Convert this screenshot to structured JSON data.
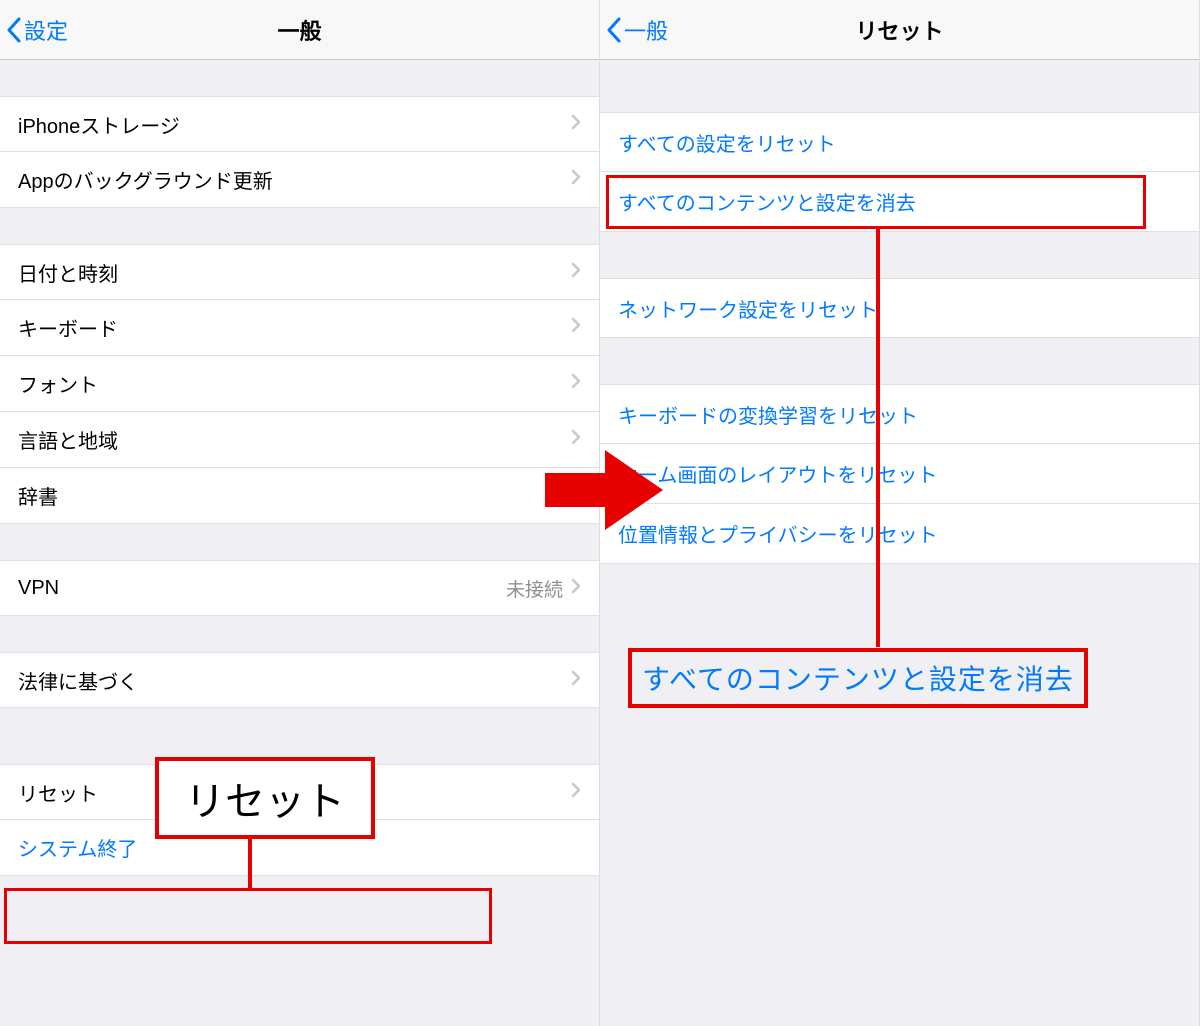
{
  "left": {
    "back_label": "設定",
    "title": "一般",
    "group1": [
      {
        "label": "iPhoneストレージ"
      },
      {
        "label": "Appのバックグラウンド更新"
      }
    ],
    "group2": [
      {
        "label": "日付と時刻"
      },
      {
        "label": "キーボード"
      },
      {
        "label": "フォント"
      },
      {
        "label": "言語と地域"
      },
      {
        "label": "辞書"
      }
    ],
    "group3": [
      {
        "label": "VPN",
        "value": "未接続"
      }
    ],
    "group4": [
      {
        "label": "法律に基づく"
      }
    ],
    "group5": [
      {
        "label": "リセット"
      }
    ],
    "shutdown": "システム終了",
    "callout": "リセット"
  },
  "right": {
    "back_label": "一般",
    "title": "リセット",
    "group1": [
      {
        "label": "すべての設定をリセット"
      },
      {
        "label": "すべてのコンテンツと設定を消去"
      }
    ],
    "group2": [
      {
        "label": "ネットワーク設定をリセット"
      }
    ],
    "group3": [
      {
        "label": "キーボードの変換学習をリセット"
      },
      {
        "label": "ホーム画面のレイアウトをリセット"
      },
      {
        "label": "位置情報とプライバシーをリセット"
      }
    ],
    "callout": "すべてのコンテンツと設定を消去"
  },
  "colors": {
    "ios_blue": "#007aff",
    "highlight_red": "#e60000"
  }
}
